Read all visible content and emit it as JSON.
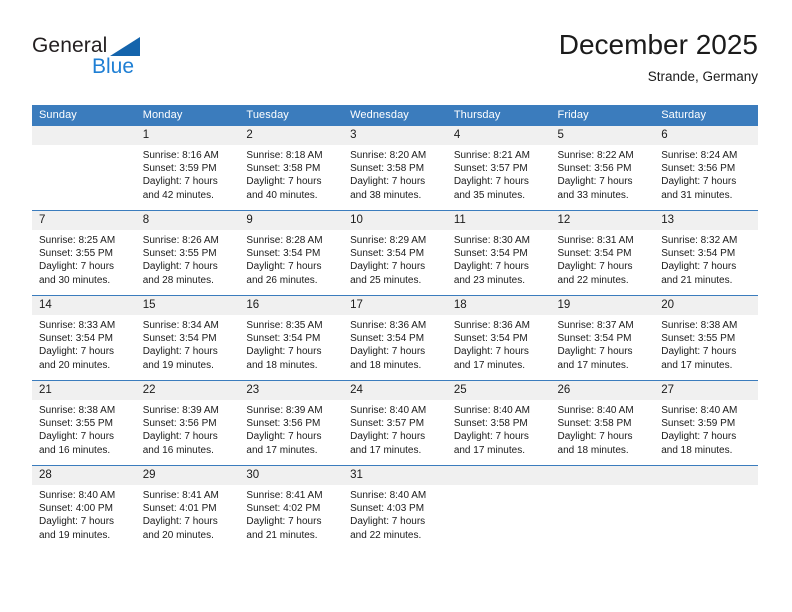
{
  "brand": {
    "name_part1": "General",
    "name_part2": "Blue",
    "accent_color": "#1f7fd4",
    "triangle_color": "#1464ac"
  },
  "header": {
    "title": "December 2025",
    "subtitle": "Strande, Germany"
  },
  "calendar": {
    "header_bg": "#3b7cbd",
    "daynum_bg": "#f0f0f0",
    "weekday_headers": [
      "Sunday",
      "Monday",
      "Tuesday",
      "Wednesday",
      "Thursday",
      "Friday",
      "Saturday"
    ],
    "weeks": [
      [
        {
          "day": "",
          "sunrise": "",
          "sunset": "",
          "daylight1": "",
          "daylight2": "",
          "empty": true
        },
        {
          "day": "1",
          "sunrise": "Sunrise: 8:16 AM",
          "sunset": "Sunset: 3:59 PM",
          "daylight1": "Daylight: 7 hours",
          "daylight2": "and 42 minutes.",
          "empty": false
        },
        {
          "day": "2",
          "sunrise": "Sunrise: 8:18 AM",
          "sunset": "Sunset: 3:58 PM",
          "daylight1": "Daylight: 7 hours",
          "daylight2": "and 40 minutes.",
          "empty": false
        },
        {
          "day": "3",
          "sunrise": "Sunrise: 8:20 AM",
          "sunset": "Sunset: 3:58 PM",
          "daylight1": "Daylight: 7 hours",
          "daylight2": "and 38 minutes.",
          "empty": false
        },
        {
          "day": "4",
          "sunrise": "Sunrise: 8:21 AM",
          "sunset": "Sunset: 3:57 PM",
          "daylight1": "Daylight: 7 hours",
          "daylight2": "and 35 minutes.",
          "empty": false
        },
        {
          "day": "5",
          "sunrise": "Sunrise: 8:22 AM",
          "sunset": "Sunset: 3:56 PM",
          "daylight1": "Daylight: 7 hours",
          "daylight2": "and 33 minutes.",
          "empty": false
        },
        {
          "day": "6",
          "sunrise": "Sunrise: 8:24 AM",
          "sunset": "Sunset: 3:56 PM",
          "daylight1": "Daylight: 7 hours",
          "daylight2": "and 31 minutes.",
          "empty": false
        }
      ],
      [
        {
          "day": "7",
          "sunrise": "Sunrise: 8:25 AM",
          "sunset": "Sunset: 3:55 PM",
          "daylight1": "Daylight: 7 hours",
          "daylight2": "and 30 minutes.",
          "empty": false
        },
        {
          "day": "8",
          "sunrise": "Sunrise: 8:26 AM",
          "sunset": "Sunset: 3:55 PM",
          "daylight1": "Daylight: 7 hours",
          "daylight2": "and 28 minutes.",
          "empty": false
        },
        {
          "day": "9",
          "sunrise": "Sunrise: 8:28 AM",
          "sunset": "Sunset: 3:54 PM",
          "daylight1": "Daylight: 7 hours",
          "daylight2": "and 26 minutes.",
          "empty": false
        },
        {
          "day": "10",
          "sunrise": "Sunrise: 8:29 AM",
          "sunset": "Sunset: 3:54 PM",
          "daylight1": "Daylight: 7 hours",
          "daylight2": "and 25 minutes.",
          "empty": false
        },
        {
          "day": "11",
          "sunrise": "Sunrise: 8:30 AM",
          "sunset": "Sunset: 3:54 PM",
          "daylight1": "Daylight: 7 hours",
          "daylight2": "and 23 minutes.",
          "empty": false
        },
        {
          "day": "12",
          "sunrise": "Sunrise: 8:31 AM",
          "sunset": "Sunset: 3:54 PM",
          "daylight1": "Daylight: 7 hours",
          "daylight2": "and 22 minutes.",
          "empty": false
        },
        {
          "day": "13",
          "sunrise": "Sunrise: 8:32 AM",
          "sunset": "Sunset: 3:54 PM",
          "daylight1": "Daylight: 7 hours",
          "daylight2": "and 21 minutes.",
          "empty": false
        }
      ],
      [
        {
          "day": "14",
          "sunrise": "Sunrise: 8:33 AM",
          "sunset": "Sunset: 3:54 PM",
          "daylight1": "Daylight: 7 hours",
          "daylight2": "and 20 minutes.",
          "empty": false
        },
        {
          "day": "15",
          "sunrise": "Sunrise: 8:34 AM",
          "sunset": "Sunset: 3:54 PM",
          "daylight1": "Daylight: 7 hours",
          "daylight2": "and 19 minutes.",
          "empty": false
        },
        {
          "day": "16",
          "sunrise": "Sunrise: 8:35 AM",
          "sunset": "Sunset: 3:54 PM",
          "daylight1": "Daylight: 7 hours",
          "daylight2": "and 18 minutes.",
          "empty": false
        },
        {
          "day": "17",
          "sunrise": "Sunrise: 8:36 AM",
          "sunset": "Sunset: 3:54 PM",
          "daylight1": "Daylight: 7 hours",
          "daylight2": "and 18 minutes.",
          "empty": false
        },
        {
          "day": "18",
          "sunrise": "Sunrise: 8:36 AM",
          "sunset": "Sunset: 3:54 PM",
          "daylight1": "Daylight: 7 hours",
          "daylight2": "and 17 minutes.",
          "empty": false
        },
        {
          "day": "19",
          "sunrise": "Sunrise: 8:37 AM",
          "sunset": "Sunset: 3:54 PM",
          "daylight1": "Daylight: 7 hours",
          "daylight2": "and 17 minutes.",
          "empty": false
        },
        {
          "day": "20",
          "sunrise": "Sunrise: 8:38 AM",
          "sunset": "Sunset: 3:55 PM",
          "daylight1": "Daylight: 7 hours",
          "daylight2": "and 17 minutes.",
          "empty": false
        }
      ],
      [
        {
          "day": "21",
          "sunrise": "Sunrise: 8:38 AM",
          "sunset": "Sunset: 3:55 PM",
          "daylight1": "Daylight: 7 hours",
          "daylight2": "and 16 minutes.",
          "empty": false
        },
        {
          "day": "22",
          "sunrise": "Sunrise: 8:39 AM",
          "sunset": "Sunset: 3:56 PM",
          "daylight1": "Daylight: 7 hours",
          "daylight2": "and 16 minutes.",
          "empty": false
        },
        {
          "day": "23",
          "sunrise": "Sunrise: 8:39 AM",
          "sunset": "Sunset: 3:56 PM",
          "daylight1": "Daylight: 7 hours",
          "daylight2": "and 17 minutes.",
          "empty": false
        },
        {
          "day": "24",
          "sunrise": "Sunrise: 8:40 AM",
          "sunset": "Sunset: 3:57 PM",
          "daylight1": "Daylight: 7 hours",
          "daylight2": "and 17 minutes.",
          "empty": false
        },
        {
          "day": "25",
          "sunrise": "Sunrise: 8:40 AM",
          "sunset": "Sunset: 3:58 PM",
          "daylight1": "Daylight: 7 hours",
          "daylight2": "and 17 minutes.",
          "empty": false
        },
        {
          "day": "26",
          "sunrise": "Sunrise: 8:40 AM",
          "sunset": "Sunset: 3:58 PM",
          "daylight1": "Daylight: 7 hours",
          "daylight2": "and 18 minutes.",
          "empty": false
        },
        {
          "day": "27",
          "sunrise": "Sunrise: 8:40 AM",
          "sunset": "Sunset: 3:59 PM",
          "daylight1": "Daylight: 7 hours",
          "daylight2": "and 18 minutes.",
          "empty": false
        }
      ],
      [
        {
          "day": "28",
          "sunrise": "Sunrise: 8:40 AM",
          "sunset": "Sunset: 4:00 PM",
          "daylight1": "Daylight: 7 hours",
          "daylight2": "and 19 minutes.",
          "empty": false
        },
        {
          "day": "29",
          "sunrise": "Sunrise: 8:41 AM",
          "sunset": "Sunset: 4:01 PM",
          "daylight1": "Daylight: 7 hours",
          "daylight2": "and 20 minutes.",
          "empty": false
        },
        {
          "day": "30",
          "sunrise": "Sunrise: 8:41 AM",
          "sunset": "Sunset: 4:02 PM",
          "daylight1": "Daylight: 7 hours",
          "daylight2": "and 21 minutes.",
          "empty": false
        },
        {
          "day": "31",
          "sunrise": "Sunrise: 8:40 AM",
          "sunset": "Sunset: 4:03 PM",
          "daylight1": "Daylight: 7 hours",
          "daylight2": "and 22 minutes.",
          "empty": false
        },
        {
          "day": "",
          "sunrise": "",
          "sunset": "",
          "daylight1": "",
          "daylight2": "",
          "empty": true
        },
        {
          "day": "",
          "sunrise": "",
          "sunset": "",
          "daylight1": "",
          "daylight2": "",
          "empty": true
        },
        {
          "day": "",
          "sunrise": "",
          "sunset": "",
          "daylight1": "",
          "daylight2": "",
          "empty": true
        }
      ]
    ]
  }
}
